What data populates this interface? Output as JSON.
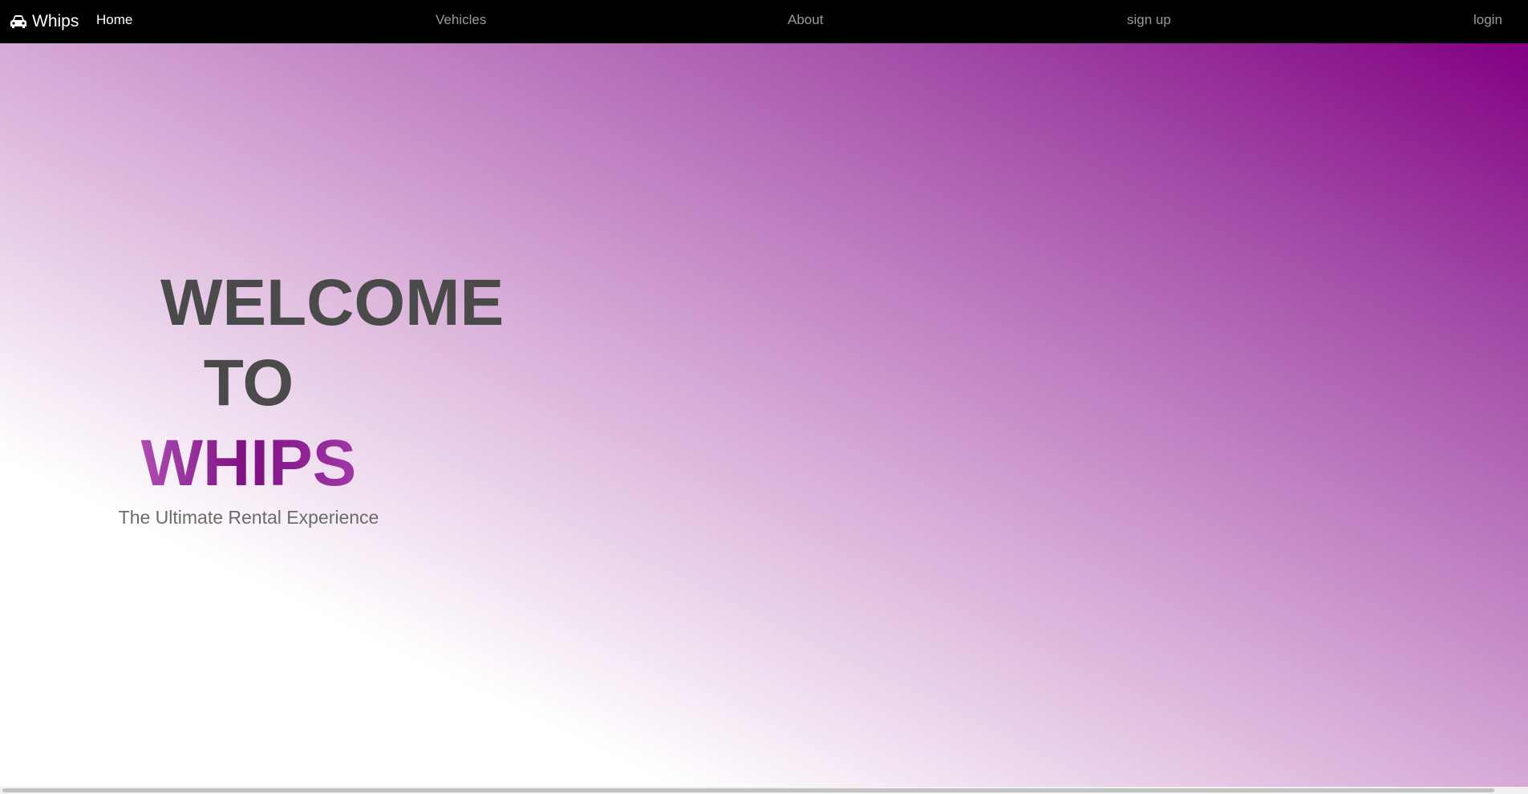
{
  "navbar": {
    "brand": "Whips",
    "links": [
      {
        "label": "Home",
        "active": true
      },
      {
        "label": "Vehicles",
        "active": false
      },
      {
        "label": "About",
        "active": false
      },
      {
        "label": "sign up",
        "active": false
      },
      {
        "label": "login",
        "active": false
      }
    ],
    "background": "#000000",
    "brand_icon": "car-icon"
  },
  "hero": {
    "line1": "WELCOME",
    "line2": "TO",
    "brand": "WHIPS",
    "subtitle": "The Ultimate Rental Experience",
    "gradient_colors": [
      "#ffffff",
      "#d6a9d6",
      "#a24ba7",
      "#820082"
    ]
  }
}
